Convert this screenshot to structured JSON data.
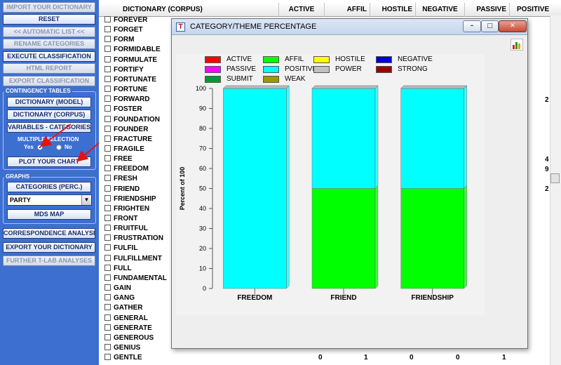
{
  "sidebar": {
    "buttons": [
      {
        "label": "IMPORT YOUR DICTIONARY",
        "disabled": true
      },
      {
        "label": "RESET",
        "disabled": false
      },
      {
        "label": "<< AUTOMATIC LIST <<",
        "disabled": true
      },
      {
        "label": "RENAME CATEGORIES",
        "disabled": true
      },
      {
        "label": "EXECUTE CLASSIFICATION",
        "disabled": false
      },
      {
        "label": "HTML REPORT",
        "disabled": true
      },
      {
        "label": "EXPORT CLASSIFICATION",
        "disabled": true
      }
    ],
    "contingency": {
      "title": "CONTINGENCY TABLES",
      "buttons": [
        "DICTIONARY (MODEL)",
        "DICTIONARY (CORPUS)",
        "VARIABLES - CATEGORIES"
      ],
      "multiple_selection_label": "MULTIPLE SELECTION",
      "yes_label": "Yes",
      "no_label": "No",
      "plot_button": "PLOT YOUR CHART"
    },
    "graphs": {
      "title": "GRAPHS",
      "categories_button": "CATEGORIES (PERC.)",
      "variable_select": "PARTY",
      "mds_button": "MDS MAP"
    },
    "bottom_buttons": [
      {
        "label": "CORRESPONDENCE ANALYSIS",
        "disabled": false
      },
      {
        "label": "EXPORT YOUR DICTIONARY",
        "disabled": false
      },
      {
        "label": "FURTHER T-LAB ANALYSES",
        "disabled": true
      }
    ]
  },
  "table": {
    "columns": [
      "DICTIONARY (CORPUS)",
      "ACTIVE",
      "AFFIL",
      "HOSTILE",
      "NEGATIVE",
      "PASSIVE",
      "POSITIVE"
    ],
    "words": [
      "FOREVER",
      "FORGET",
      "FORM",
      "FORMIDABLE",
      "FORMULATE",
      "FORTIFY",
      "FORTUNATE",
      "FORTUNE",
      "FORWARD",
      "FOSTER",
      "FOUNDATION",
      "FOUNDER",
      "FRACTURE",
      "FRAGILE",
      "FREE",
      "FREEDOM",
      "FRESH",
      "FRIEND",
      "FRIENDSHIP",
      "FRIGHTEN",
      "FRONT",
      "FRUITFUL",
      "FRUSTRATION",
      "FULFIL",
      "FULFILLMENT",
      "FULL",
      "FUNDAMENTAL",
      "GAIN",
      "GANG",
      "GATHER",
      "GENERAL",
      "GENERATE",
      "GENEROUS",
      "GENIUS",
      "GENTLE"
    ],
    "visible_positive_values": [
      {
        "word": "FORWARD",
        "value": "2"
      },
      {
        "word": "FREE",
        "value": "4"
      },
      {
        "word": "FREEDOM",
        "value": "9"
      },
      {
        "word": "FRIEND",
        "value": "2"
      }
    ],
    "last_row": {
      "word": "GENTLE",
      "active": "0",
      "affil": "1",
      "hostile": "0",
      "negative": "0",
      "passive": "1"
    }
  },
  "window": {
    "title": "CATEGORY/THEME PERCENTAGE",
    "minimize": "–",
    "maximize": "□",
    "close": "✕"
  },
  "legend": [
    {
      "name": "ACTIVE",
      "color": "#ff0000"
    },
    {
      "name": "AFFIL",
      "color": "#00ff00"
    },
    {
      "name": "HOSTILE",
      "color": "#ffff00"
    },
    {
      "name": "NEGATIVE",
      "color": "#0000cc"
    },
    {
      "name": "PASSIVE",
      "color": "#ff00ff"
    },
    {
      "name": "POSITIVE",
      "color": "#00ffff"
    },
    {
      "name": "POWER",
      "color": "#c0c0c0"
    },
    {
      "name": "STRONG",
      "color": "#990000"
    },
    {
      "name": "SUBMIT",
      "color": "#009933"
    },
    {
      "name": "WEAK",
      "color": "#999900"
    }
  ],
  "chart_data": {
    "type": "bar",
    "stacked": true,
    "categories": [
      "FREEDOM",
      "FRIEND",
      "FRIENDSHIP"
    ],
    "series": [
      {
        "name": "AFFIL",
        "color": "#00ff00",
        "values": [
          0,
          50,
          50
        ]
      },
      {
        "name": "POSITIVE",
        "color": "#00ffff",
        "values": [
          100,
          50,
          50
        ]
      }
    ],
    "ylabel": "Percent of 100",
    "ylim": [
      0,
      100
    ],
    "yticks": [
      0,
      10,
      20,
      30,
      40,
      50,
      60,
      70,
      80,
      90,
      100
    ],
    "grid": false
  }
}
